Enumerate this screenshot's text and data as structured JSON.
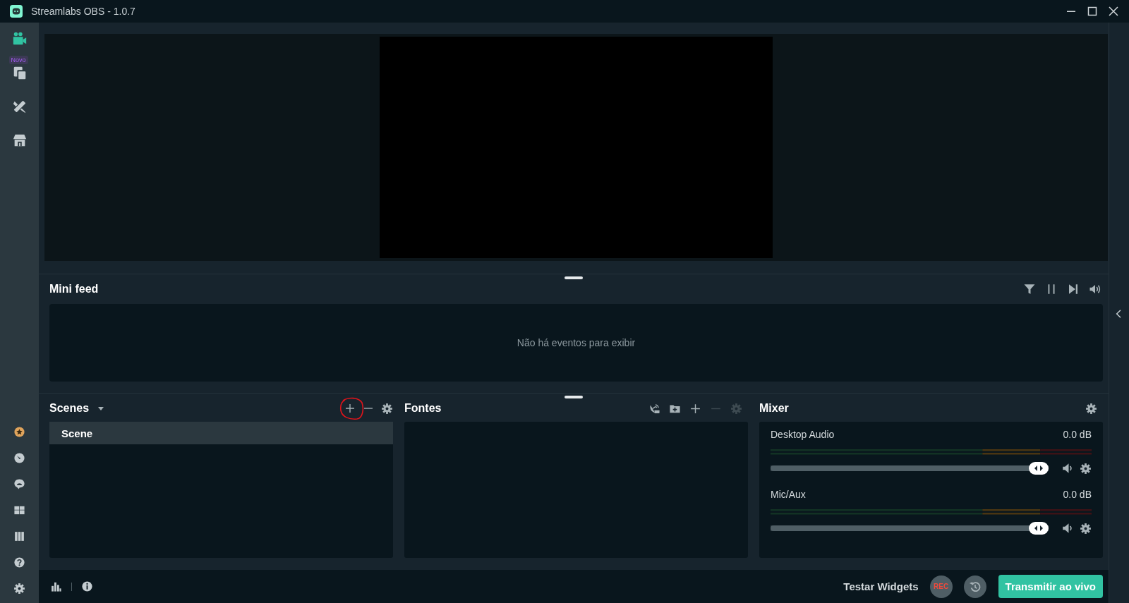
{
  "window": {
    "title": "Streamlabs OBS - 1.0.7"
  },
  "nav": {
    "top": [
      {
        "selected": true
      },
      {
        "selected": false,
        "badge": "Novo"
      },
      {
        "selected": false
      },
      {
        "selected": false
      }
    ],
    "bottom": [
      {
        "selected": false
      },
      {
        "selected": false
      },
      {
        "selected": false
      },
      {
        "selected": false
      },
      {
        "selected": false
      },
      {
        "selected": false
      },
      {
        "selected": false
      }
    ]
  },
  "mini_feed": {
    "title": "Mini feed",
    "empty_text": "Não há eventos para exibir"
  },
  "scenes": {
    "title": "Scenes",
    "add_highlighted": true,
    "items": [
      {
        "label": "Scene",
        "selected": true
      }
    ]
  },
  "sources": {
    "title": "Fontes",
    "tools": [
      {
        "kind": "dish",
        "disabled": false
      },
      {
        "kind": "folder",
        "disabled": false
      },
      {
        "kind": "add",
        "disabled": false
      },
      {
        "kind": "remove",
        "disabled": true
      },
      {
        "kind": "settings",
        "disabled": true
      }
    ]
  },
  "mixer": {
    "title": "Mixer",
    "channels": [
      {
        "name": "Desktop Audio",
        "reading": "0.0 dB",
        "level": 0.97
      },
      {
        "name": "Mic/Aux",
        "reading": "0.0 dB",
        "level": 0.97
      }
    ]
  },
  "footer": {
    "test_widgets": "Testar Widgets",
    "rec": "REC",
    "go_live": "Transmitir ao vivo"
  }
}
